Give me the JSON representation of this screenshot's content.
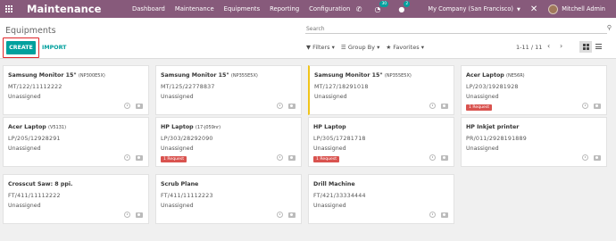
{
  "topbar": {
    "app_title": "Maintenance",
    "menu": [
      "Dashboard",
      "Maintenance",
      "Equipments",
      "Reporting",
      "Configuration"
    ],
    "phone_icon": "phone-icon",
    "activity_badge": "30",
    "messages_badge": "2",
    "company": "My Company (San Francisco)",
    "user": "Mitchell Admin",
    "brand_color": "#875a7b"
  },
  "control": {
    "breadcrumb": "Equipments",
    "search_placeholder": "Search",
    "create_label": "CREATE",
    "import_label": "IMPORT",
    "filters_label": "Filters",
    "group_by_label": "Group By",
    "favorites_label": "Favorites",
    "pager": "1-11 / 11",
    "accent_color": "#00a09d"
  },
  "cards": [
    {
      "title": "Samsung Monitor 15\"",
      "model": "(NP300E5X)",
      "serial": "MT/122/11112222",
      "owner": "Unassigned",
      "request": ""
    },
    {
      "title": "Samsung Monitor 15\"",
      "model": "(NP355E5X)",
      "serial": "MT/125/22778837",
      "owner": "Unassigned",
      "request": ""
    },
    {
      "title": "Samsung Monitor 15\"",
      "model": "(NP355E5X)",
      "serial": "MT/127/18291018",
      "owner": "Unassigned",
      "request": ""
    },
    {
      "title": "Acer Laptop",
      "model": "(NE56R)",
      "serial": "LP/203/19281928",
      "owner": "Unassigned",
      "request": "1 Request"
    },
    {
      "title": "Acer Laptop",
      "model": "(V5131)",
      "serial": "LP/205/12928291",
      "owner": "Unassigned",
      "request": ""
    },
    {
      "title": "HP Laptop",
      "model": "(17-j059nr)",
      "serial": "LP/303/28292090",
      "owner": "Unassigned",
      "request": "1 Request"
    },
    {
      "title": "HP Laptop",
      "model": "",
      "serial": "LP/305/17281718",
      "owner": "Unassigned",
      "request": "1 Request"
    },
    {
      "title": "HP Inkjet printer",
      "model": "",
      "serial": "PR/011/2928191889",
      "owner": "Unassigned",
      "request": ""
    },
    {
      "title": "Crosscut Saw: 8 ppi.",
      "model": "",
      "serial": "FT/411/11112222",
      "owner": "Unassigned",
      "request": ""
    },
    {
      "title": "Scrub Plane",
      "model": "",
      "serial": "FT/411/11112223",
      "owner": "Unassigned",
      "request": ""
    },
    {
      "title": "Drill Machine",
      "model": "",
      "serial": "FT/421/33334444",
      "owner": "Unassigned",
      "request": ""
    }
  ]
}
